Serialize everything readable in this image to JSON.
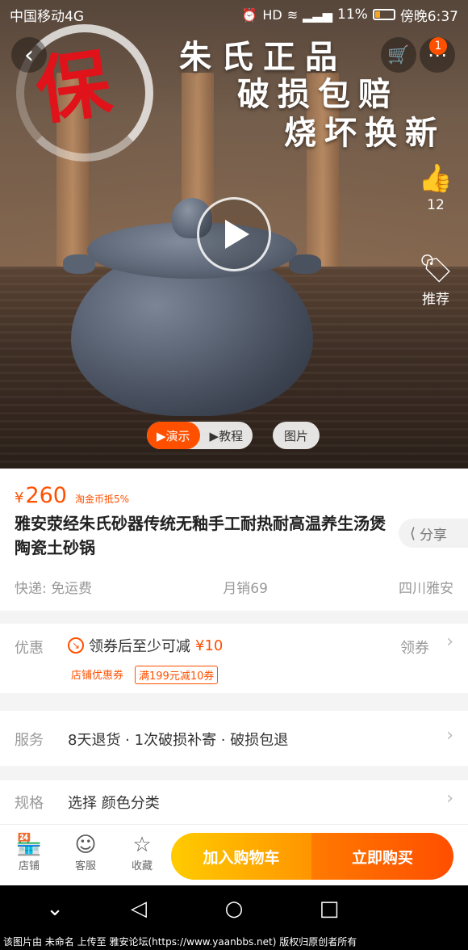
{
  "status_bar": {
    "carrier": "中国移动4G",
    "battery": "11%",
    "time": "傍晚6:37"
  },
  "hero": {
    "seal_char": "保",
    "slogan": [
      "朱氏正品",
      "破损包赔",
      "烧坏换新"
    ],
    "cart_badge": "1",
    "like_count": "12",
    "recommend_label": "推荐",
    "media_tabs": [
      "▶演示",
      "▶教程"
    ],
    "picture_tab": "图片"
  },
  "product": {
    "currency": "¥",
    "price": "260",
    "tao_coin": "淘金币抵5%",
    "title": "雅安荥经朱氏砂器传统无釉手工耐热耐高温养生汤煲陶瓷土砂锅",
    "share_label": "分享",
    "shipping": "快递: 免运费",
    "monthly_sales": "月销69",
    "location": "四川雅安"
  },
  "coupon": {
    "label": "优惠",
    "text": "领券后至少可减",
    "amount": "¥10",
    "action": "领券",
    "tags": [
      "店铺优惠券",
      "满199元减10券"
    ]
  },
  "service": {
    "label": "服务",
    "text": "8天退货 · 1次破损补寄 · 破损包退"
  },
  "spec": {
    "label": "规格",
    "text": "选择 颜色分类"
  },
  "bottom_bar": {
    "shop": "店铺",
    "customer_service": "客服",
    "favorite": "收藏",
    "add_to_cart": "加入购物车",
    "buy_now": "立即购买"
  },
  "footnote": "该图片由 未命名 上传至 雅安论坛(https://www.yaanbbs.net) 版权归原创者所有",
  "colors": {
    "accent": "#ff5000",
    "add_cart_gradient": [
      "#ffcb00",
      "#ff9500"
    ],
    "buy_gradient": [
      "#ff7a00",
      "#ff4e00"
    ]
  }
}
